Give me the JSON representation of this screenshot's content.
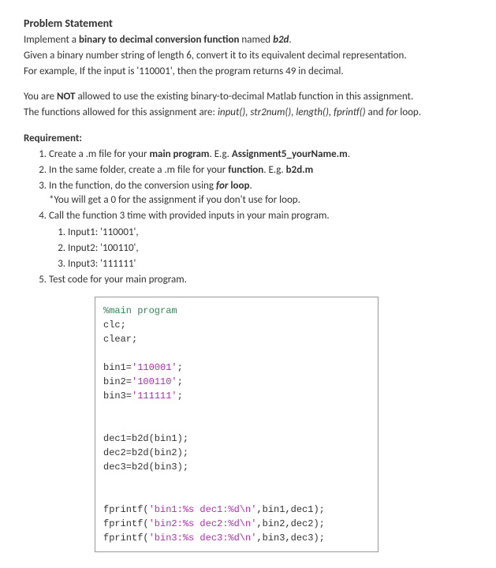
{
  "heading": "Problem Statement",
  "intro_line1_pre": "Implement a ",
  "intro_line1_bold": "binary to decimal conversion function",
  "intro_line1_mid": " named ",
  "intro_line1_name": "b2d",
  "intro_line1_post": ".",
  "intro_line2": "Given a binary number string of length 6, convert it to its equivalent decimal representation.",
  "intro_line3": "For example, If the input is '110001', then the program returns 49 in decimal.",
  "restrict_line1_pre": "You are ",
  "restrict_line1_bold": "NOT",
  "restrict_line1_post": " allowed to use the existing binary-to-decimal Matlab function in this assignment.",
  "restrict_line2_pre": "The functions allowed for this assignment are: ",
  "restrict_line2_funcs": "input(), str2num(), length(), fprintf()",
  "restrict_line2_mid": " and ",
  "restrict_line2_for": "for",
  "restrict_line2_post": " loop.",
  "requirement_heading": "Requirement:",
  "req": [
    {
      "pre": "Create a .m file for your ",
      "bold": "main program",
      "mid": ". E.g. ",
      "bold2": "Assignment5_yourName.m",
      "post": "."
    },
    {
      "pre": "In the same folder, create a .m file for your ",
      "bold": "function",
      "mid": ". E.g. ",
      "bold2": "b2d.m",
      "post": ""
    },
    {
      "pre": "In the function, do the conversion using ",
      "bolditalic": "for",
      "bold": " loop",
      "post": "."
    }
  ],
  "req3_note": "*You will get a 0 for the assignment if you don't use for loop.",
  "req4": "Call the function 3 time with provided inputs in your main program.",
  "req4_inputs": [
    "Input1: '110001',",
    "Input2: '100110',",
    "Input3: '111111'"
  ],
  "req5": "Test code for your main program.",
  "code": {
    "comment": "%main program",
    "l2": "clc;",
    "l3": "clear;",
    "bin1_pre": "bin1=",
    "bin1_str": "'110001'",
    "bin1_post": ";",
    "bin2_pre": "bin2=",
    "bin2_str": "'100110'",
    "bin2_post": ";",
    "bin3_pre": "bin3=",
    "bin3_str": "'111111'",
    "bin3_post": ";",
    "dec1": "dec1=b2d(bin1);",
    "dec2": "dec2=b2d(bin2);",
    "dec3": "dec3=b2d(bin3);",
    "fp1_pre": "fprintf(",
    "fp1_str": "'bin1:%s dec1:%d\\n'",
    "fp1_post": ",bin1,dec1);",
    "fp2_pre": "fprintf(",
    "fp2_str": "'bin2:%s dec2:%d\\n'",
    "fp2_post": ",bin2,dec2);",
    "fp3_pre": "fprintf(",
    "fp3_str": "'bin3:%s dec3:%d\\n'",
    "fp3_post": ",bin3,dec3);"
  }
}
